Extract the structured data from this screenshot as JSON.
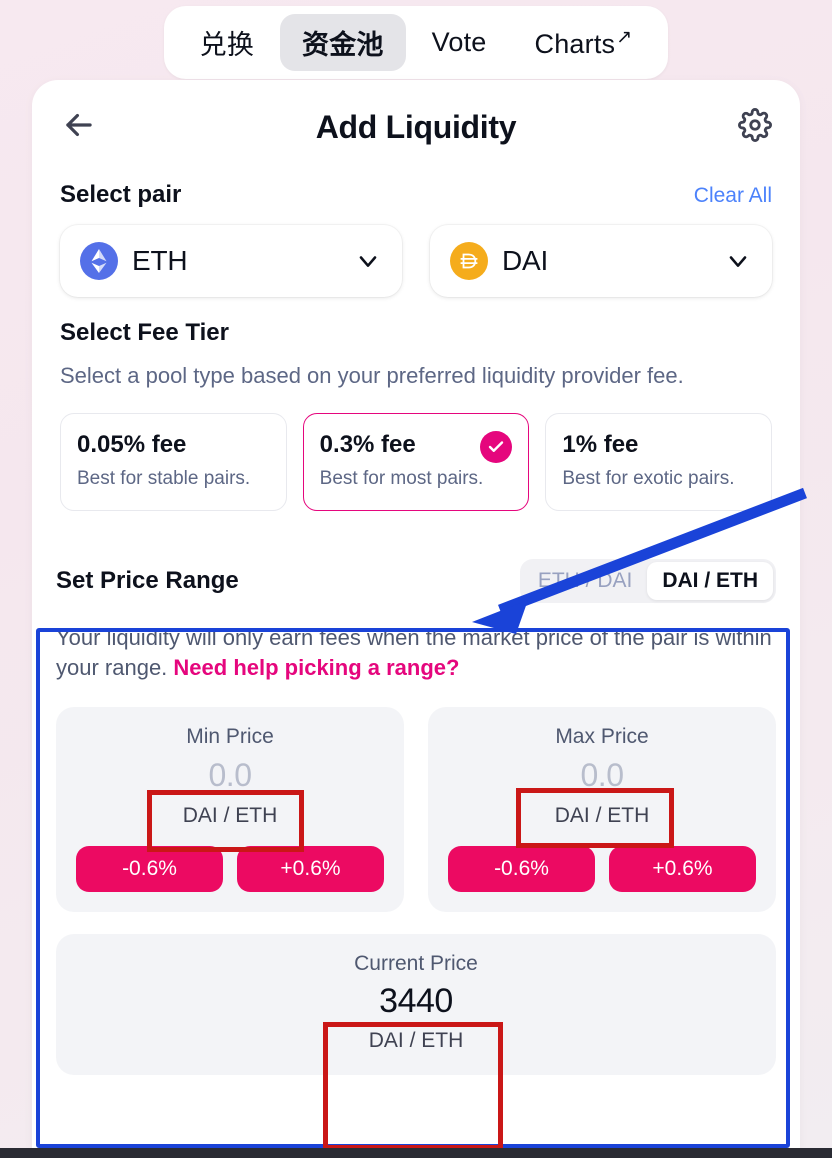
{
  "nav": {
    "items": [
      {
        "label": "兑换",
        "active": false,
        "external": false
      },
      {
        "label": "资金池",
        "active": true,
        "external": false
      },
      {
        "label": "Vote",
        "active": false,
        "external": false
      },
      {
        "label": "Charts",
        "active": false,
        "external": true
      }
    ],
    "external_glyph": "↗"
  },
  "header": {
    "back_icon": "arrow-left-icon",
    "title": "Add Liquidity",
    "settings_icon": "gear-icon"
  },
  "select_pair": {
    "title": "Select pair",
    "clear_all": "Clear All",
    "tokens": [
      {
        "symbol": "ETH",
        "icon": "eth-token-icon",
        "color": "#5470e8",
        "chevron": "chevron-down-icon"
      },
      {
        "symbol": "DAI",
        "icon": "dai-token-icon",
        "color": "#f5ac1c",
        "chevron": "chevron-down-icon"
      }
    ]
  },
  "fee_tier": {
    "title": "Select Fee Tier",
    "description": "Select a pool type based on your preferred liquidity provider fee.",
    "selected_color": "#e5067d",
    "options": [
      {
        "amount": "0.05% fee",
        "subtitle": "Best for stable pairs.",
        "selected": false
      },
      {
        "amount": "0.3% fee",
        "subtitle": "Best for most pairs.",
        "selected": true
      },
      {
        "amount": "1% fee",
        "subtitle": "Best for exotic pairs.",
        "selected": false
      }
    ],
    "check_icon": "check-icon"
  },
  "price_range": {
    "title": "Set Price Range",
    "toggle": {
      "inactive": "ETH / DAI",
      "active": "DAI / ETH"
    },
    "description_prefix": "Your liquidity will only earn fees when the market price of the pair is within your range. ",
    "description_link": "Need help picking a range?",
    "min": {
      "label": "Min Price",
      "value": "0.0",
      "pair": "DAI / ETH",
      "decrement": "-0.6%",
      "increment": "+0.6%"
    },
    "max": {
      "label": "Max Price",
      "value": "0.0",
      "pair": "DAI / ETH",
      "decrement": "-0.6%",
      "increment": "+0.6%"
    },
    "current": {
      "label": "Current Price",
      "value": "3440",
      "pair": "DAI / ETH"
    },
    "accent_pink": "#ec0a62"
  },
  "annotations": {
    "blue_box_color": "#1a43d8",
    "red_box_color": "#ca1717",
    "arrow": "blue-arrow-pointing-to-price-range"
  }
}
